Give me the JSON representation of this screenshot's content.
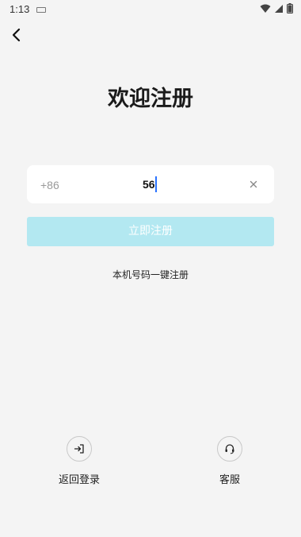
{
  "status_bar": {
    "time": "1:13",
    "icons": [
      "keyboard-icon",
      "wifi-icon",
      "signal-icon",
      "battery-icon"
    ]
  },
  "nav": {
    "back_icon": "chevron-left-icon"
  },
  "page": {
    "title": "欢迎注册"
  },
  "phone_input": {
    "country_code": "+86",
    "value": "56",
    "clear_icon": "close-icon"
  },
  "register_button": {
    "label": "立即注册",
    "color": "#b3e8f1"
  },
  "one_key_register": {
    "label": "本机号码一键注册"
  },
  "bottom_actions": {
    "back_to_login": {
      "label": "返回登录",
      "icon": "login-icon"
    },
    "customer_service": {
      "label": "客服",
      "icon": "headset-icon"
    }
  }
}
